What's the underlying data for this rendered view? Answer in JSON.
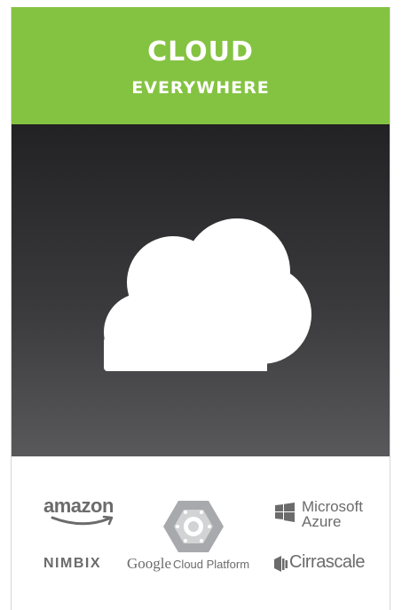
{
  "header": {
    "title": "CLOUD",
    "subtitle": "EVERYWHERE",
    "bg_color": "#84c341",
    "text_color": "#ffffff"
  },
  "hero": {
    "icon": "cloud-icon",
    "gradient_top": "#222123",
    "gradient_bottom": "#59595b",
    "icon_color": "#ffffff"
  },
  "logos": {
    "amazon": "amazon",
    "microsoft_line1": "Microsoft",
    "microsoft_line2": "Azure",
    "nimbix": "NIMBIX",
    "google_word": "Google",
    "google_rest": "Cloud Platform",
    "cirrascale": "Cirrascale",
    "logo_color": "#6b6b6b"
  }
}
